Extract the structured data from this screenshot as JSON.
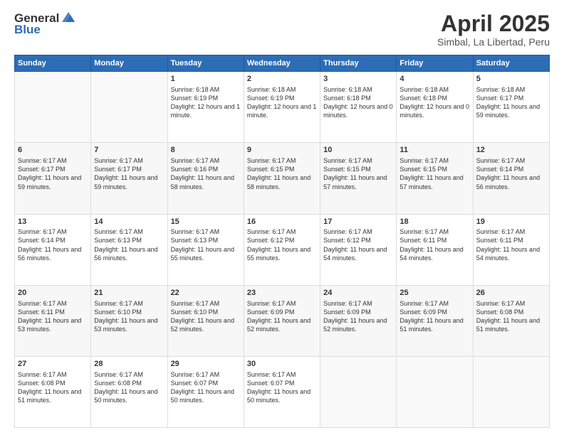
{
  "header": {
    "logo_line1": "General",
    "logo_line2": "Blue",
    "month_title": "April 2025",
    "location": "Simbal, La Libertad, Peru"
  },
  "weekdays": [
    "Sunday",
    "Monday",
    "Tuesday",
    "Wednesday",
    "Thursday",
    "Friday",
    "Saturday"
  ],
  "weeks": [
    [
      {
        "day": "",
        "sunrise": "",
        "sunset": "",
        "daylight": ""
      },
      {
        "day": "",
        "sunrise": "",
        "sunset": "",
        "daylight": ""
      },
      {
        "day": "1",
        "sunrise": "Sunrise: 6:18 AM",
        "sunset": "Sunset: 6:19 PM",
        "daylight": "Daylight: 12 hours and 1 minute."
      },
      {
        "day": "2",
        "sunrise": "Sunrise: 6:18 AM",
        "sunset": "Sunset: 6:19 PM",
        "daylight": "Daylight: 12 hours and 1 minute."
      },
      {
        "day": "3",
        "sunrise": "Sunrise: 6:18 AM",
        "sunset": "Sunset: 6:18 PM",
        "daylight": "Daylight: 12 hours and 0 minutes."
      },
      {
        "day": "4",
        "sunrise": "Sunrise: 6:18 AM",
        "sunset": "Sunset: 6:18 PM",
        "daylight": "Daylight: 12 hours and 0 minutes."
      },
      {
        "day": "5",
        "sunrise": "Sunrise: 6:18 AM",
        "sunset": "Sunset: 6:17 PM",
        "daylight": "Daylight: 11 hours and 59 minutes."
      }
    ],
    [
      {
        "day": "6",
        "sunrise": "Sunrise: 6:17 AM",
        "sunset": "Sunset: 6:17 PM",
        "daylight": "Daylight: 11 hours and 59 minutes."
      },
      {
        "day": "7",
        "sunrise": "Sunrise: 6:17 AM",
        "sunset": "Sunset: 6:17 PM",
        "daylight": "Daylight: 11 hours and 59 minutes."
      },
      {
        "day": "8",
        "sunrise": "Sunrise: 6:17 AM",
        "sunset": "Sunset: 6:16 PM",
        "daylight": "Daylight: 11 hours and 58 minutes."
      },
      {
        "day": "9",
        "sunrise": "Sunrise: 6:17 AM",
        "sunset": "Sunset: 6:15 PM",
        "daylight": "Daylight: 11 hours and 58 minutes."
      },
      {
        "day": "10",
        "sunrise": "Sunrise: 6:17 AM",
        "sunset": "Sunset: 6:15 PM",
        "daylight": "Daylight: 11 hours and 57 minutes."
      },
      {
        "day": "11",
        "sunrise": "Sunrise: 6:17 AM",
        "sunset": "Sunset: 6:15 PM",
        "daylight": "Daylight: 11 hours and 57 minutes."
      },
      {
        "day": "12",
        "sunrise": "Sunrise: 6:17 AM",
        "sunset": "Sunset: 6:14 PM",
        "daylight": "Daylight: 11 hours and 56 minutes."
      }
    ],
    [
      {
        "day": "13",
        "sunrise": "Sunrise: 6:17 AM",
        "sunset": "Sunset: 6:14 PM",
        "daylight": "Daylight: 11 hours and 56 minutes."
      },
      {
        "day": "14",
        "sunrise": "Sunrise: 6:17 AM",
        "sunset": "Sunset: 6:13 PM",
        "daylight": "Daylight: 11 hours and 56 minutes."
      },
      {
        "day": "15",
        "sunrise": "Sunrise: 6:17 AM",
        "sunset": "Sunset: 6:13 PM",
        "daylight": "Daylight: 11 hours and 55 minutes."
      },
      {
        "day": "16",
        "sunrise": "Sunrise: 6:17 AM",
        "sunset": "Sunset: 6:12 PM",
        "daylight": "Daylight: 11 hours and 55 minutes."
      },
      {
        "day": "17",
        "sunrise": "Sunrise: 6:17 AM",
        "sunset": "Sunset: 6:12 PM",
        "daylight": "Daylight: 11 hours and 54 minutes."
      },
      {
        "day": "18",
        "sunrise": "Sunrise: 6:17 AM",
        "sunset": "Sunset: 6:11 PM",
        "daylight": "Daylight: 11 hours and 54 minutes."
      },
      {
        "day": "19",
        "sunrise": "Sunrise: 6:17 AM",
        "sunset": "Sunset: 6:11 PM",
        "daylight": "Daylight: 11 hours and 54 minutes."
      }
    ],
    [
      {
        "day": "20",
        "sunrise": "Sunrise: 6:17 AM",
        "sunset": "Sunset: 6:11 PM",
        "daylight": "Daylight: 11 hours and 53 minutes."
      },
      {
        "day": "21",
        "sunrise": "Sunrise: 6:17 AM",
        "sunset": "Sunset: 6:10 PM",
        "daylight": "Daylight: 11 hours and 53 minutes."
      },
      {
        "day": "22",
        "sunrise": "Sunrise: 6:17 AM",
        "sunset": "Sunset: 6:10 PM",
        "daylight": "Daylight: 11 hours and 52 minutes."
      },
      {
        "day": "23",
        "sunrise": "Sunrise: 6:17 AM",
        "sunset": "Sunset: 6:09 PM",
        "daylight": "Daylight: 11 hours and 52 minutes."
      },
      {
        "day": "24",
        "sunrise": "Sunrise: 6:17 AM",
        "sunset": "Sunset: 6:09 PM",
        "daylight": "Daylight: 11 hours and 52 minutes."
      },
      {
        "day": "25",
        "sunrise": "Sunrise: 6:17 AM",
        "sunset": "Sunset: 6:09 PM",
        "daylight": "Daylight: 11 hours and 51 minutes."
      },
      {
        "day": "26",
        "sunrise": "Sunrise: 6:17 AM",
        "sunset": "Sunset: 6:08 PM",
        "daylight": "Daylight: 11 hours and 51 minutes."
      }
    ],
    [
      {
        "day": "27",
        "sunrise": "Sunrise: 6:17 AM",
        "sunset": "Sunset: 6:08 PM",
        "daylight": "Daylight: 11 hours and 51 minutes."
      },
      {
        "day": "28",
        "sunrise": "Sunrise: 6:17 AM",
        "sunset": "Sunset: 6:08 PM",
        "daylight": "Daylight: 11 hours and 50 minutes."
      },
      {
        "day": "29",
        "sunrise": "Sunrise: 6:17 AM",
        "sunset": "Sunset: 6:07 PM",
        "daylight": "Daylight: 11 hours and 50 minutes."
      },
      {
        "day": "30",
        "sunrise": "Sunrise: 6:17 AM",
        "sunset": "Sunset: 6:07 PM",
        "daylight": "Daylight: 11 hours and 50 minutes."
      },
      {
        "day": "",
        "sunrise": "",
        "sunset": "",
        "daylight": ""
      },
      {
        "day": "",
        "sunrise": "",
        "sunset": "",
        "daylight": ""
      },
      {
        "day": "",
        "sunrise": "",
        "sunset": "",
        "daylight": ""
      }
    ]
  ]
}
